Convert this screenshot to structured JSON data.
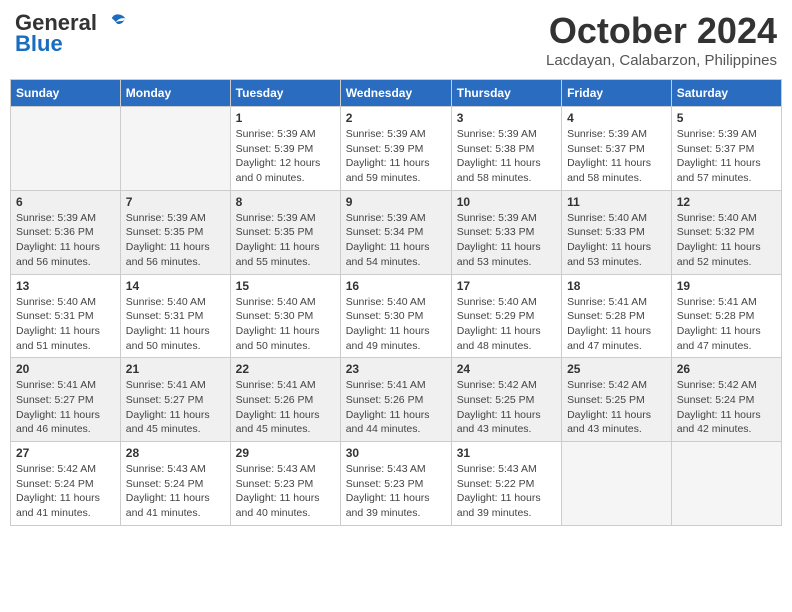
{
  "logo": {
    "text_general": "General",
    "text_blue": "Blue"
  },
  "title": {
    "month": "October 2024",
    "location": "Lacdayan, Calabarzon, Philippines"
  },
  "headers": [
    "Sunday",
    "Monday",
    "Tuesday",
    "Wednesday",
    "Thursday",
    "Friday",
    "Saturday"
  ],
  "weeks": [
    [
      {
        "day": "",
        "info": ""
      },
      {
        "day": "",
        "info": ""
      },
      {
        "day": "1",
        "info": "Sunrise: 5:39 AM\nSunset: 5:39 PM\nDaylight: 12 hours and 0 minutes."
      },
      {
        "day": "2",
        "info": "Sunrise: 5:39 AM\nSunset: 5:39 PM\nDaylight: 11 hours and 59 minutes."
      },
      {
        "day": "3",
        "info": "Sunrise: 5:39 AM\nSunset: 5:38 PM\nDaylight: 11 hours and 58 minutes."
      },
      {
        "day": "4",
        "info": "Sunrise: 5:39 AM\nSunset: 5:37 PM\nDaylight: 11 hours and 58 minutes."
      },
      {
        "day": "5",
        "info": "Sunrise: 5:39 AM\nSunset: 5:37 PM\nDaylight: 11 hours and 57 minutes."
      }
    ],
    [
      {
        "day": "6",
        "info": "Sunrise: 5:39 AM\nSunset: 5:36 PM\nDaylight: 11 hours and 56 minutes."
      },
      {
        "day": "7",
        "info": "Sunrise: 5:39 AM\nSunset: 5:35 PM\nDaylight: 11 hours and 56 minutes."
      },
      {
        "day": "8",
        "info": "Sunrise: 5:39 AM\nSunset: 5:35 PM\nDaylight: 11 hours and 55 minutes."
      },
      {
        "day": "9",
        "info": "Sunrise: 5:39 AM\nSunset: 5:34 PM\nDaylight: 11 hours and 54 minutes."
      },
      {
        "day": "10",
        "info": "Sunrise: 5:39 AM\nSunset: 5:33 PM\nDaylight: 11 hours and 53 minutes."
      },
      {
        "day": "11",
        "info": "Sunrise: 5:40 AM\nSunset: 5:33 PM\nDaylight: 11 hours and 53 minutes."
      },
      {
        "day": "12",
        "info": "Sunrise: 5:40 AM\nSunset: 5:32 PM\nDaylight: 11 hours and 52 minutes."
      }
    ],
    [
      {
        "day": "13",
        "info": "Sunrise: 5:40 AM\nSunset: 5:31 PM\nDaylight: 11 hours and 51 minutes."
      },
      {
        "day": "14",
        "info": "Sunrise: 5:40 AM\nSunset: 5:31 PM\nDaylight: 11 hours and 50 minutes."
      },
      {
        "day": "15",
        "info": "Sunrise: 5:40 AM\nSunset: 5:30 PM\nDaylight: 11 hours and 50 minutes."
      },
      {
        "day": "16",
        "info": "Sunrise: 5:40 AM\nSunset: 5:30 PM\nDaylight: 11 hours and 49 minutes."
      },
      {
        "day": "17",
        "info": "Sunrise: 5:40 AM\nSunset: 5:29 PM\nDaylight: 11 hours and 48 minutes."
      },
      {
        "day": "18",
        "info": "Sunrise: 5:41 AM\nSunset: 5:28 PM\nDaylight: 11 hours and 47 minutes."
      },
      {
        "day": "19",
        "info": "Sunrise: 5:41 AM\nSunset: 5:28 PM\nDaylight: 11 hours and 47 minutes."
      }
    ],
    [
      {
        "day": "20",
        "info": "Sunrise: 5:41 AM\nSunset: 5:27 PM\nDaylight: 11 hours and 46 minutes."
      },
      {
        "day": "21",
        "info": "Sunrise: 5:41 AM\nSunset: 5:27 PM\nDaylight: 11 hours and 45 minutes."
      },
      {
        "day": "22",
        "info": "Sunrise: 5:41 AM\nSunset: 5:26 PM\nDaylight: 11 hours and 45 minutes."
      },
      {
        "day": "23",
        "info": "Sunrise: 5:41 AM\nSunset: 5:26 PM\nDaylight: 11 hours and 44 minutes."
      },
      {
        "day": "24",
        "info": "Sunrise: 5:42 AM\nSunset: 5:25 PM\nDaylight: 11 hours and 43 minutes."
      },
      {
        "day": "25",
        "info": "Sunrise: 5:42 AM\nSunset: 5:25 PM\nDaylight: 11 hours and 43 minutes."
      },
      {
        "day": "26",
        "info": "Sunrise: 5:42 AM\nSunset: 5:24 PM\nDaylight: 11 hours and 42 minutes."
      }
    ],
    [
      {
        "day": "27",
        "info": "Sunrise: 5:42 AM\nSunset: 5:24 PM\nDaylight: 11 hours and 41 minutes."
      },
      {
        "day": "28",
        "info": "Sunrise: 5:43 AM\nSunset: 5:24 PM\nDaylight: 11 hours and 41 minutes."
      },
      {
        "day": "29",
        "info": "Sunrise: 5:43 AM\nSunset: 5:23 PM\nDaylight: 11 hours and 40 minutes."
      },
      {
        "day": "30",
        "info": "Sunrise: 5:43 AM\nSunset: 5:23 PM\nDaylight: 11 hours and 39 minutes."
      },
      {
        "day": "31",
        "info": "Sunrise: 5:43 AM\nSunset: 5:22 PM\nDaylight: 11 hours and 39 minutes."
      },
      {
        "day": "",
        "info": ""
      },
      {
        "day": "",
        "info": ""
      }
    ]
  ]
}
